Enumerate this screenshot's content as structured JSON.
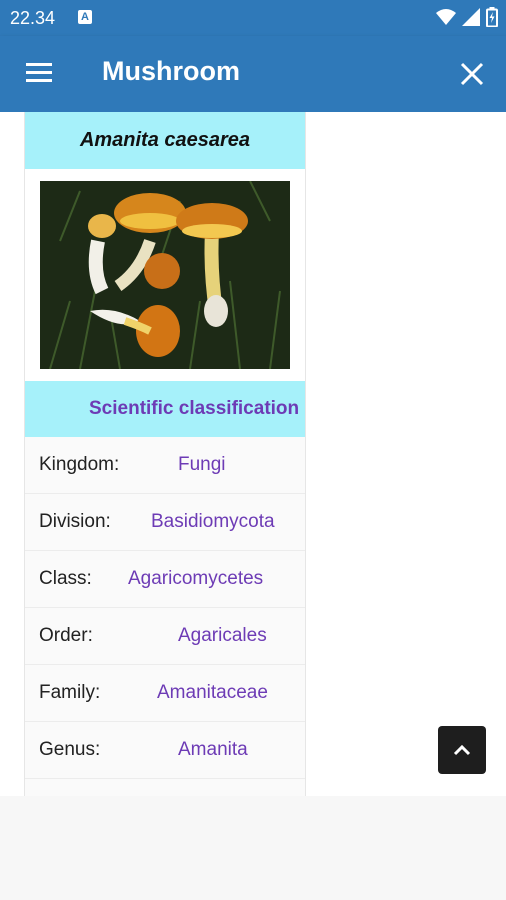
{
  "status_bar": {
    "time": "22.34",
    "notification_letter": "A",
    "icons": [
      "wifi-icon",
      "signal-icon",
      "battery-icon"
    ]
  },
  "app_bar": {
    "title": "Mushroom",
    "icons": [
      "menu-icon",
      "close-icon"
    ]
  },
  "species": {
    "name": "Amanita caesarea",
    "section_title": "Scientific classification",
    "classification": [
      {
        "label": "Kingdom:",
        "value": "Fungi"
      },
      {
        "label": "Division:",
        "value": "Basidiomycota"
      },
      {
        "label": "Class:",
        "value": "Agaricomycetes"
      },
      {
        "label": "Order:",
        "value": "Agaricales"
      },
      {
        "label": "Family:",
        "value": "Amanitaceae"
      },
      {
        "label": "Genus:",
        "value": "Amanita"
      }
    ]
  },
  "fab": {
    "icon": "chevron-up-icon"
  },
  "colors": {
    "app_bar": "#2f79b9",
    "header_bg": "#a6f1fa",
    "value_text": "#6d3bb5",
    "fab_bg": "#1e1e1e"
  }
}
